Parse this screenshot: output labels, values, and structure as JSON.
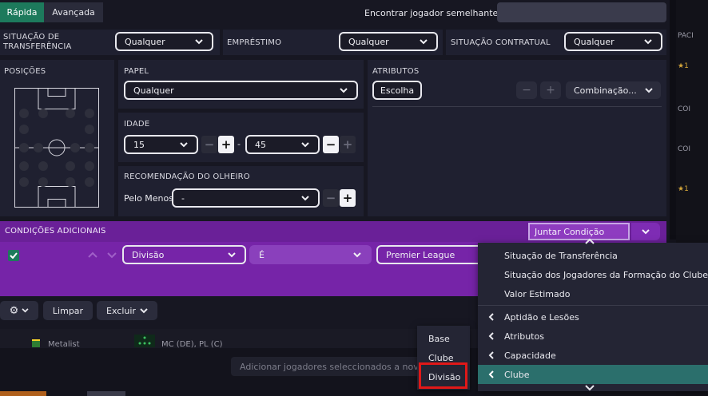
{
  "tabs": {
    "quick": "Rápida",
    "advanced": "Avançada"
  },
  "search": {
    "label": "Encontrar jogador semelhante a",
    "placeholder": ""
  },
  "filters_row": {
    "transfer_status_label": "SITUAÇÃO DE TRANSFERÊNCIA",
    "transfer_status_value": "Qualquer",
    "loan_label": "EMPRÉSTIMO",
    "loan_value": "Qualquer",
    "contract_label": "SITUAÇÃO CONTRATUAL",
    "contract_value": "Qualquer"
  },
  "positions": {
    "label": "POSIÇÕES"
  },
  "role": {
    "label": "PAPEL",
    "value": "Qualquer"
  },
  "age": {
    "label": "IDADE",
    "min": "15",
    "max": "45",
    "separator": "-"
  },
  "scout": {
    "label": "RECOMENDAÇÃO DO OLHEIRO",
    "prefix": "Pelo Menos",
    "value": "-"
  },
  "attributes": {
    "label": "ATRIBUTOS",
    "choose": "Escolha",
    "combination": "Combinação...",
    "minus": "−",
    "plus": "+"
  },
  "conditions": {
    "label": "CONDIÇÕES ADICIONAIS",
    "join": "Juntar Condição",
    "field": "Divisão",
    "operator": "É",
    "value": "Premier League"
  },
  "toolbar": {
    "clear": "Limpar",
    "delete": "Excluir"
  },
  "dropdown_menu": {
    "items": [
      {
        "label": "Situação de Transferência",
        "arrow": false
      },
      {
        "label": "Situação dos Jogadores da Formação do Clube",
        "arrow": false
      },
      {
        "label": "Valor Estimado",
        "arrow": false
      },
      {
        "label": "Aptidão e Lesões",
        "arrow": true
      },
      {
        "label": "Atributos",
        "arrow": true
      },
      {
        "label": "Capacidade",
        "arrow": true
      },
      {
        "label": "Clube",
        "arrow": true
      }
    ]
  },
  "submenu": {
    "items": [
      "Base",
      "Clube",
      "Divisão"
    ]
  },
  "background": {
    "row_club": "Metalist",
    "row_position": "MC (DE), PL (C)",
    "bottom_hint": "Adicionar jogadores seleccionados a nova li",
    "side_label_1": "PACI",
    "side_label_2": "COI",
    "side_label_3": "COI",
    "side_label_4": "COI"
  },
  "colors": {
    "accent_green": "#1d7a5c",
    "purple": "#7624a8",
    "teal_highlight": "#2b6f6c",
    "red_outline": "#e01818"
  }
}
